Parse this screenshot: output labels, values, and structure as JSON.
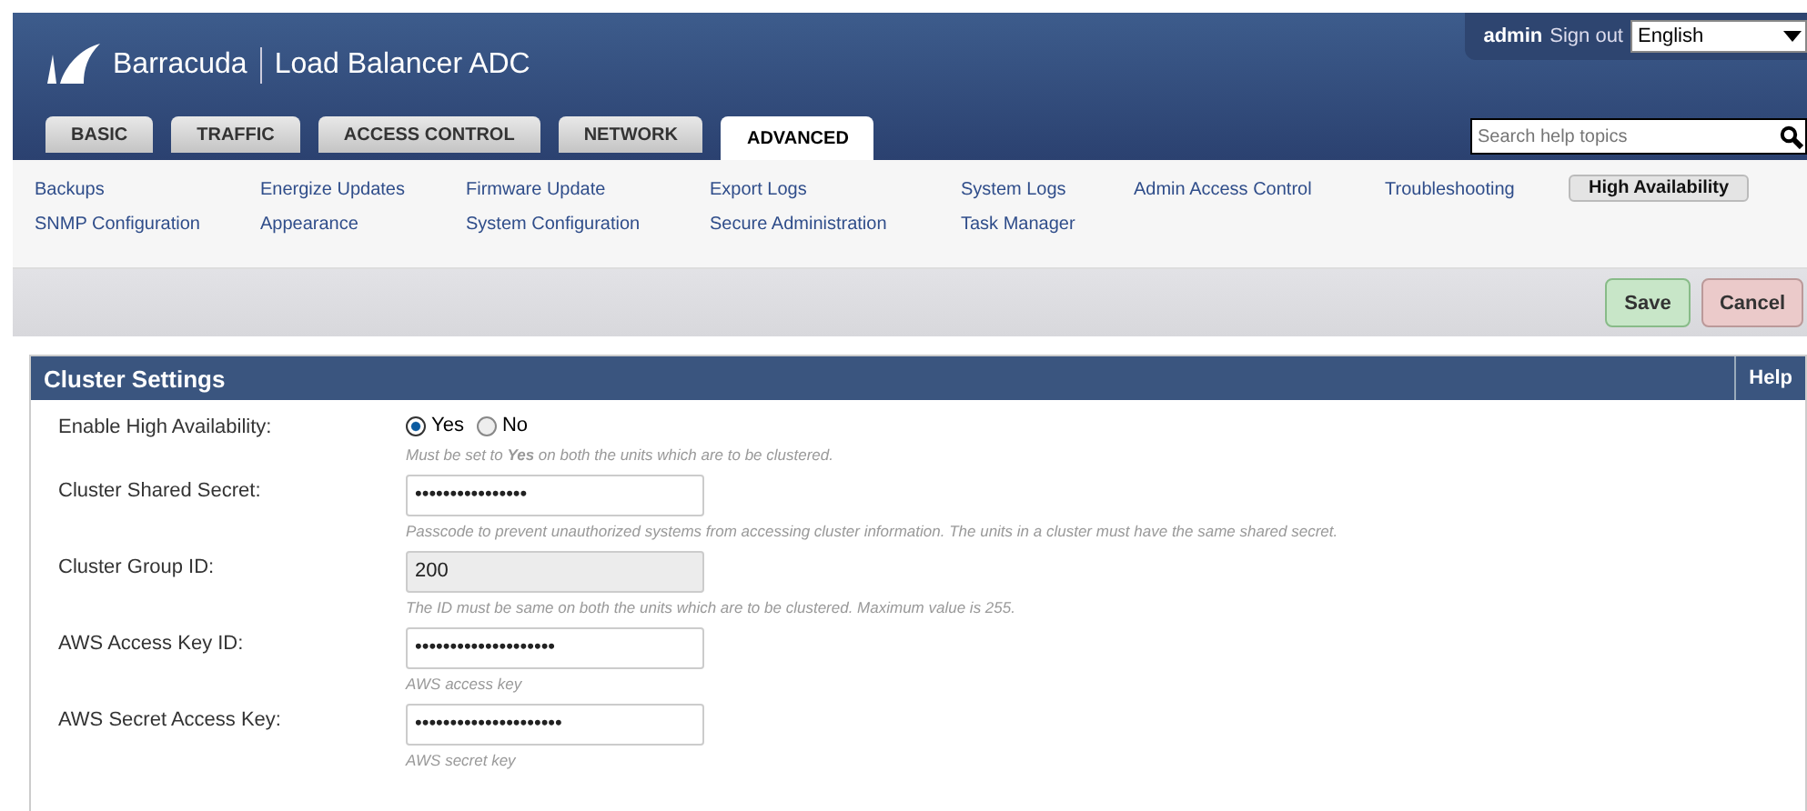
{
  "header": {
    "brand": "Barracuda",
    "product": "Load Balancer ADC",
    "user": "admin",
    "sign_out": "Sign out",
    "language": "English",
    "search": {
      "placeholder": "Search help topics"
    }
  },
  "tabs": [
    {
      "label": "BASIC",
      "selected": false
    },
    {
      "label": "TRAFFIC",
      "selected": false
    },
    {
      "label": "ACCESS CONTROL",
      "selected": false
    },
    {
      "label": "NETWORK",
      "selected": false
    },
    {
      "label": "ADVANCED",
      "selected": true
    }
  ],
  "subnav": [
    {
      "label": "Backups",
      "selected": false
    },
    {
      "label": "SNMP Configuration",
      "selected": false
    },
    {
      "label": "Energize Updates",
      "selected": false
    },
    {
      "label": "Appearance",
      "selected": false
    },
    {
      "label": "Firmware Update",
      "selected": false
    },
    {
      "label": "System Configuration",
      "selected": false
    },
    {
      "label": "Export Logs",
      "selected": false
    },
    {
      "label": "Secure Administration",
      "selected": false
    },
    {
      "label": "System Logs",
      "selected": false
    },
    {
      "label": "Task Manager",
      "selected": false
    },
    {
      "label": "Admin Access Control",
      "selected": false
    },
    {
      "label": "Troubleshooting",
      "selected": false
    },
    {
      "label": "High Availability",
      "selected": true
    }
  ],
  "actions": {
    "save": "Save",
    "cancel": "Cancel"
  },
  "panel": {
    "title": "Cluster Settings",
    "help": "Help",
    "rows": [
      {
        "kind": "radio",
        "label": "Enable High Availability:",
        "options": [
          {
            "label": "Yes",
            "selected": true
          },
          {
            "label": "No",
            "selected": false
          }
        ],
        "hint": "Must be set to **Yes** on both the units which are to be clustered."
      },
      {
        "kind": "field",
        "label": "Cluster Shared Secret:",
        "value": "••••••••••••••••",
        "disabled": false,
        "hint": "Passcode to prevent unauthorized systems from accessing cluster information. The units in a cluster must have the same shared secret."
      },
      {
        "kind": "field",
        "label": "Cluster Group ID:",
        "value": "200",
        "disabled": true,
        "hint": "The ID must be same on both the units which are to be clustered. Maximum value is 255."
      },
      {
        "kind": "field",
        "label": "AWS Access Key ID:",
        "value": "••••••••••••••••••••",
        "disabled": false,
        "hint": "AWS access key"
      },
      {
        "kind": "field",
        "label": "AWS Secret Access Key:",
        "value": "•••••••••••••••••••••",
        "disabled": false,
        "hint": "AWS secret key"
      }
    ]
  }
}
